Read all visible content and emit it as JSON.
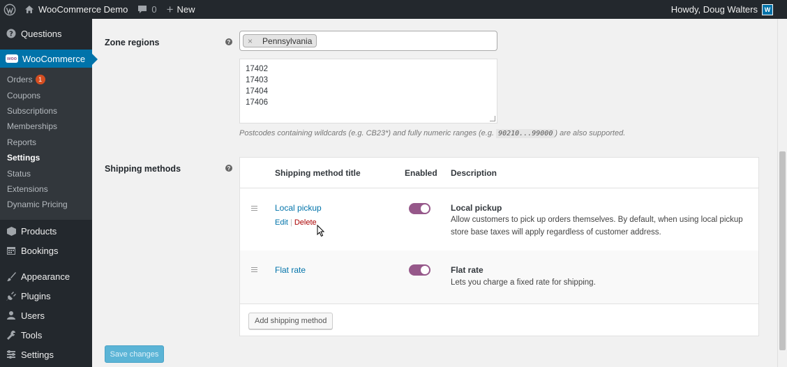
{
  "adminbar": {
    "site_name": "WooCommerce Demo",
    "comments_count": "0",
    "new_label": "New",
    "howdy": "Howdy, Doug Walters",
    "avatar_letter": "W"
  },
  "sidebar": {
    "top_item": "Questions",
    "woocommerce_label": "WooCommerce",
    "woo_logo_text": "woo",
    "submenu": [
      {
        "label": "Orders",
        "badge": "1"
      },
      {
        "label": "Coupons"
      },
      {
        "label": "Subscriptions"
      },
      {
        "label": "Memberships"
      },
      {
        "label": "Reports"
      },
      {
        "label": "Settings"
      },
      {
        "label": "Status"
      },
      {
        "label": "Extensions"
      },
      {
        "label": "Dynamic Pricing"
      }
    ],
    "items": [
      {
        "label": "Products",
        "icon": "products-icon"
      },
      {
        "label": "Bookings",
        "icon": "calendar-icon"
      },
      {
        "label": "Appearance",
        "icon": "brush-icon"
      },
      {
        "label": "Plugins",
        "icon": "plugin-icon"
      },
      {
        "label": "Users",
        "icon": "user-icon"
      },
      {
        "label": "Tools",
        "icon": "wrench-icon"
      },
      {
        "label": "Settings",
        "icon": "settings-icon"
      }
    ]
  },
  "zone": {
    "regions_label": "Zone regions",
    "help": "?",
    "selected_region": "Pennsylvania",
    "remove_glyph": "×",
    "postcodes": [
      "17402",
      "17403",
      "17404",
      "17406"
    ],
    "note_before": "Postcodes containing wildcards (e.g. CB23*) and fully numeric ranges (e.g. ",
    "note_code": "90210...99000",
    "note_after": ") are also supported."
  },
  "shipping": {
    "label": "Shipping methods",
    "help": "?",
    "columns": {
      "title": "Shipping method title",
      "enabled": "Enabled",
      "description": "Description"
    },
    "methods": [
      {
        "title": "Local pickup",
        "edit": "Edit",
        "delete": "Delete",
        "enabled": true,
        "desc_title": "Local pickup",
        "desc": "Allow customers to pick up orders themselves. By default, when using local pickup store base taxes will apply regardless of customer address."
      },
      {
        "title": "Flat rate",
        "enabled": true,
        "desc_title": "Flat rate",
        "desc": "Lets you charge a fixed rate for shipping."
      }
    ],
    "add_button": "Add shipping method"
  },
  "save_button": "Save changes",
  "colors": {
    "accent": "#0073aa",
    "toggle": "#96588a",
    "sidebar": "#23282d",
    "delete": "#aa0000"
  }
}
